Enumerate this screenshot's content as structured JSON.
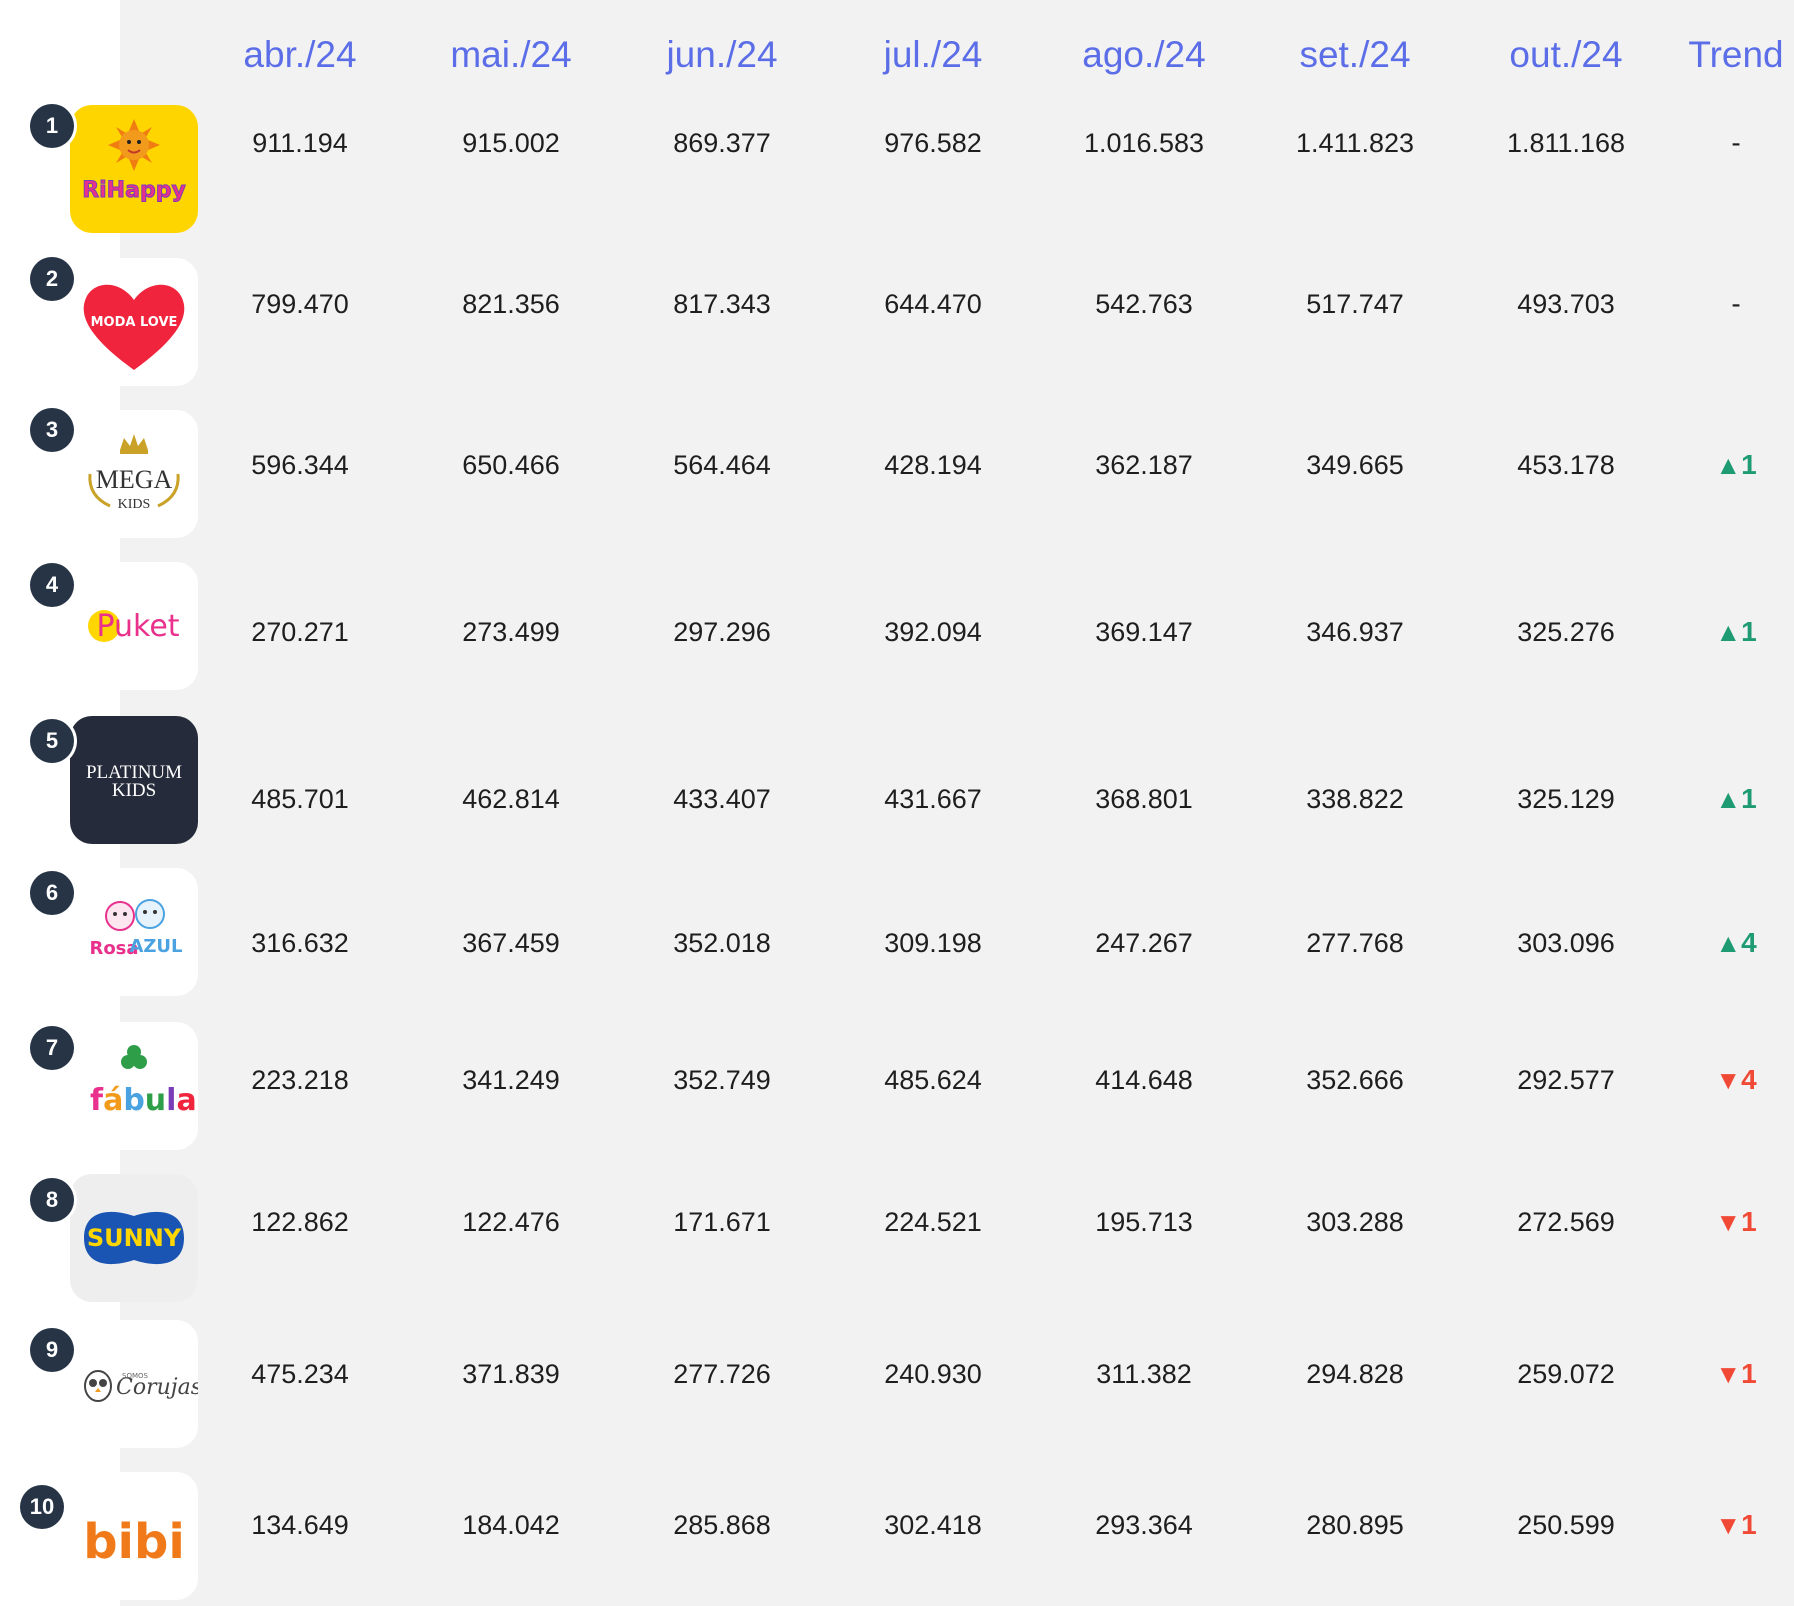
{
  "chart_data": {
    "type": "table",
    "columns": [
      "abr./24",
      "mai./24",
      "jun./24",
      "jul./24",
      "ago./24",
      "set./24",
      "out./24"
    ],
    "trend_header": "Trend",
    "rows": [
      {
        "rank": "1",
        "brand": "Ri Happy",
        "logo_icon": "ri-happy-logo-icon",
        "values": [
          "911.194",
          "915.002",
          "869.377",
          "976.582",
          "1.016.583",
          "1.411.823",
          "1.811.168"
        ],
        "trend": {
          "direction": "flat",
          "text": "-"
        }
      },
      {
        "rank": "2",
        "brand": "MODA LOVE",
        "logo_icon": "moda-love-logo-icon",
        "values": [
          "799.470",
          "821.356",
          "817.343",
          "644.470",
          "542.763",
          "517.747",
          "493.703"
        ],
        "trend": {
          "direction": "flat",
          "text": "-"
        }
      },
      {
        "rank": "3",
        "brand": "MEGA KIDS",
        "logo_icon": "mega-kids-logo-icon",
        "values": [
          "596.344",
          "650.466",
          "564.464",
          "428.194",
          "362.187",
          "349.665",
          "453.178"
        ],
        "trend": {
          "direction": "up",
          "text": "1"
        }
      },
      {
        "rank": "4",
        "brand": "Puket",
        "logo_icon": "puket-logo-icon",
        "values": [
          "270.271",
          "273.499",
          "297.296",
          "392.094",
          "369.147",
          "346.937",
          "325.276"
        ],
        "trend": {
          "direction": "up",
          "text": "1"
        }
      },
      {
        "rank": "5",
        "brand": "PLATINUM KIDS",
        "logo_icon": "platinum-kids-logo-icon",
        "values": [
          "485.701",
          "462.814",
          "433.407",
          "431.667",
          "368.801",
          "338.822",
          "325.129"
        ],
        "trend": {
          "direction": "up",
          "text": "1"
        }
      },
      {
        "rank": "6",
        "brand": "Rosa Azul Kids",
        "logo_icon": "rosa-azul-logo-icon",
        "values": [
          "316.632",
          "367.459",
          "352.018",
          "309.198",
          "247.267",
          "277.768",
          "303.096"
        ],
        "trend": {
          "direction": "up",
          "text": "4"
        }
      },
      {
        "rank": "7",
        "brand": "fábula",
        "logo_icon": "fabula-logo-icon",
        "values": [
          "223.218",
          "341.249",
          "352.749",
          "485.624",
          "414.648",
          "352.666",
          "292.577"
        ],
        "trend": {
          "direction": "down",
          "text": "4"
        }
      },
      {
        "rank": "8",
        "brand": "SUNNY",
        "logo_icon": "sunny-logo-icon",
        "values": [
          "122.862",
          "122.476",
          "171.671",
          "224.521",
          "195.713",
          "303.288",
          "272.569"
        ],
        "trend": {
          "direction": "down",
          "text": "1"
        }
      },
      {
        "rank": "9",
        "brand": "Somos Corujas",
        "logo_icon": "somos-corujas-logo-icon",
        "values": [
          "475.234",
          "371.839",
          "277.726",
          "240.930",
          "311.382",
          "294.828",
          "259.072"
        ],
        "trend": {
          "direction": "down",
          "text": "1"
        }
      },
      {
        "rank": "10",
        "brand": "bibi",
        "logo_icon": "bibi-logo-icon",
        "values": [
          "134.649",
          "184.042",
          "285.868",
          "302.418",
          "293.364",
          "280.895",
          "250.599"
        ],
        "trend": {
          "direction": "down",
          "text": "1"
        }
      }
    ]
  },
  "colors": {
    "header": "#5b6ee8",
    "trend_up": "#1f9b74",
    "trend_down": "#f04a36",
    "badge": "#263446",
    "panel": "#f2f2f2"
  },
  "icons": {
    "trend_up": "triangle-up-icon",
    "trend_down": "triangle-down-icon"
  }
}
